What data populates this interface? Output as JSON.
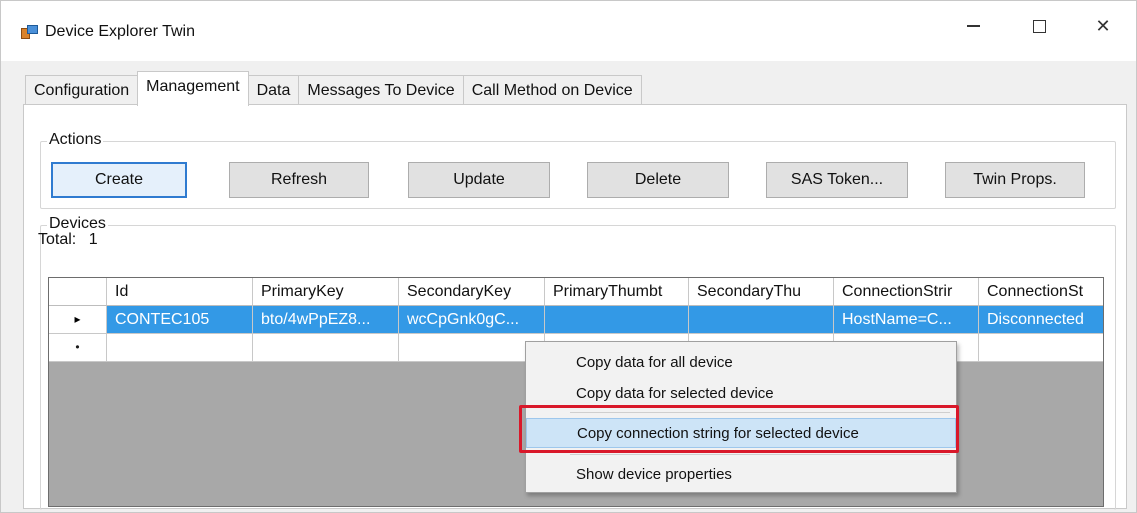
{
  "window": {
    "title": "Device Explorer Twin",
    "controls": {
      "minimize": "minimize-icon",
      "maximize": "maximize-icon",
      "close": "✕"
    }
  },
  "tabs": [
    {
      "label": "Configuration",
      "active": false
    },
    {
      "label": "Management",
      "active": true
    },
    {
      "label": "Data",
      "active": false
    },
    {
      "label": "Messages To Device",
      "active": false
    },
    {
      "label": "Call Method on Device",
      "active": false
    }
  ],
  "actions": {
    "group_label": "Actions",
    "buttons": [
      "Create",
      "Refresh",
      "Update",
      "Delete",
      "SAS Token...",
      "Twin Props."
    ]
  },
  "devices": {
    "group_label": "Devices",
    "total_label": "Total:",
    "total_value": "1",
    "columns": [
      "Id",
      "PrimaryKey",
      "SecondaryKey",
      "PrimaryThumbt",
      "SecondaryThu",
      "ConnectionStrir",
      "ConnectionSt"
    ],
    "rows": [
      {
        "marker": "▸",
        "cells": [
          "CONTEC105",
          "bto/4wPpEZ8...",
          "wcCpGnk0gC...",
          "",
          "",
          "HostName=C...",
          "Disconnected"
        ]
      },
      {
        "marker": "•",
        "cells": [
          "",
          "",
          "",
          "",
          "",
          "",
          ""
        ]
      }
    ],
    "selected_color": "#3399e6"
  },
  "context_menu": {
    "items": [
      "Copy data for all device",
      "Copy data for selected device",
      "Copy connection string for selected device",
      "Show device properties"
    ],
    "hovered_index": 2,
    "highlight_color": "#d9182a"
  }
}
